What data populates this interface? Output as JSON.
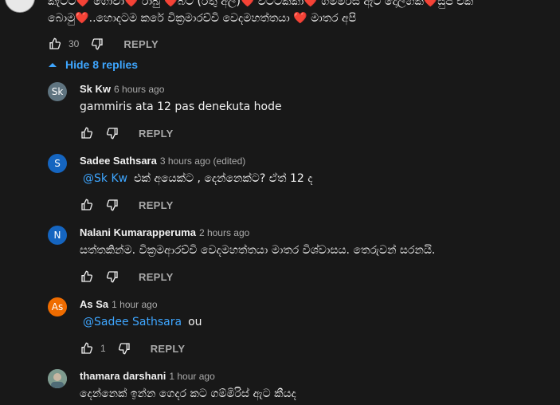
{
  "top_comment": {
    "line1": "කැටට❤️ ගෝවා❤️ රාබු ❤️බිට (රතු අල)❤️ වට්ටක්කා❤️ ගම්මිරිස් ඇට දොලහක්❤️සුප් එක",
    "line2": "බොමු❤️..හොදටම  කරේ වික්‍රමාරච්චි වෙදමහත්තයා ❤️   මාතර අපි",
    "likes": "30",
    "reply_label": "REPLY"
  },
  "hide_replies_label": "Hide 8 replies",
  "replies": [
    {
      "avatar_text": "Sk",
      "avatar_color": "#5f7480",
      "author": "Sk Kw",
      "time": "6 hours ago",
      "mention": "",
      "text": "gammiris ata 12  pas denekuta hode",
      "likes": "",
      "reply_label": "REPLY"
    },
    {
      "avatar_text": "S",
      "avatar_color": "#1565c0",
      "author": "Sadee Sathsara",
      "time": "3 hours ago (edited)",
      "mention": "@Sk Kw",
      "text": "එක් අයෙක්ට , දෙන්නෙක්ට? ඒත් 12 ද",
      "likes": "",
      "reply_label": "REPLY"
    },
    {
      "avatar_text": "N",
      "avatar_color": "#1565c0",
      "author": "Nalani Kumarapperuma",
      "time": "2 hours ago",
      "mention": "",
      "text": "සත්තකින්ම. වික්‍රමආරච්චි වෙදමහත්තයා මාතර විශ්වාසය. තෙරුවන් සරනයි.",
      "likes": "",
      "reply_label": "REPLY"
    },
    {
      "avatar_text": "As",
      "avatar_color": "#ef6c00",
      "author": "As Sa",
      "time": "1 hour ago",
      "mention": "@Sadee Sathsara",
      "text": "ou",
      "likes": "1",
      "reply_label": "REPLY"
    },
    {
      "avatar_text": "",
      "avatar_color": "#6b8a8f",
      "author": "thamara darshani",
      "time": "1 hour ago",
      "mention": "",
      "text": "දෙන්නෙක් ඉන්න ගෙදර කට ගම්මිරිස් ඇට කීයද",
      "likes": "",
      "reply_label": ""
    }
  ]
}
